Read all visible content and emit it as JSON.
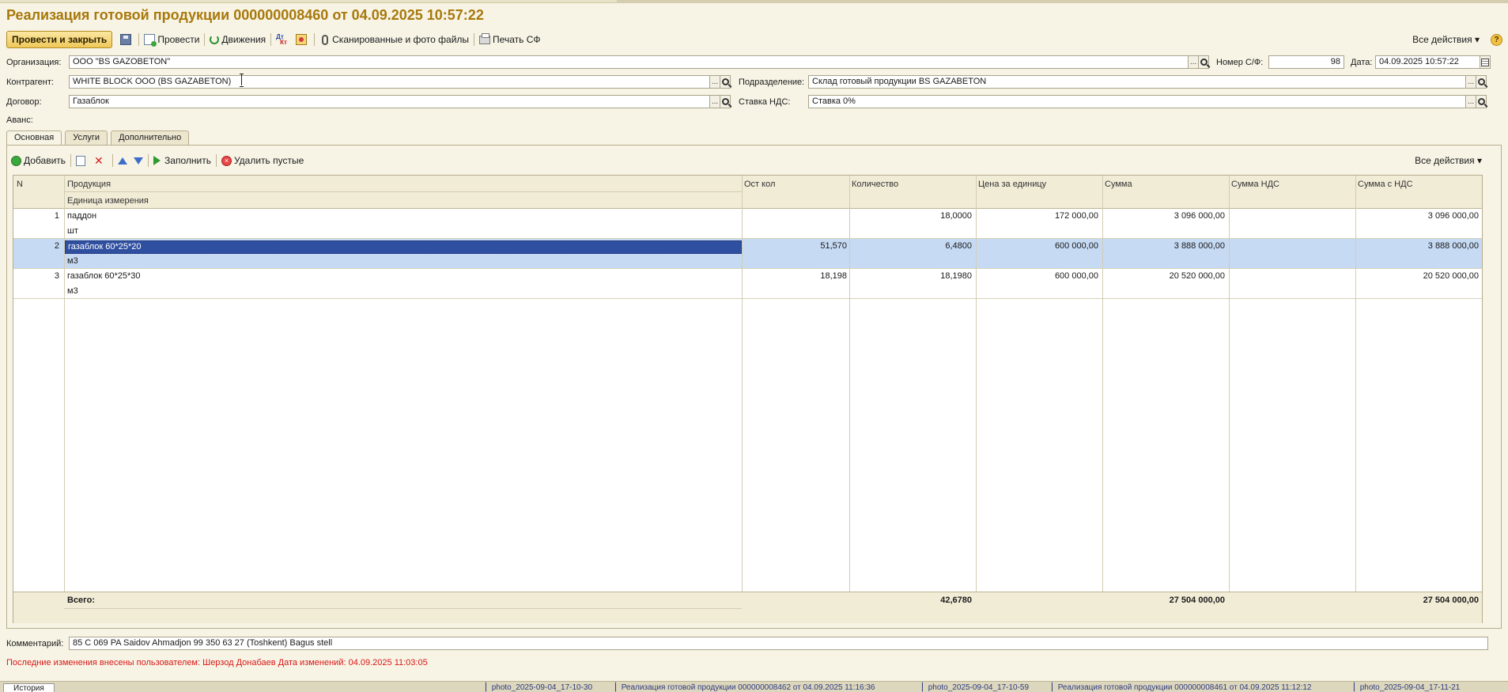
{
  "document": {
    "title": "Реализация готовой продукции 000000008460 от 04.09.2025 10:57:22"
  },
  "toolbar": {
    "post_and_close": "Провести и закрыть",
    "post": "Провести",
    "movements": "Движения",
    "scans": "Сканированные и фото файлы",
    "print_invoice": "Печать СФ",
    "all_actions": "Все действия ▾",
    "help": "?"
  },
  "form": {
    "organization_label": "Организация:",
    "organization_value": "ООО \"BS GAZOBETON\"",
    "invoice_no_label": "Номер С/Ф:",
    "invoice_no_value": "98",
    "date_label": "Дата:",
    "date_value": "04.09.2025 10:57:22",
    "counterparty_label": "Контрагент:",
    "counterparty_value": "WHITE BLOCK OOO (BS GAZABETON)",
    "division_label": "Подразделение:",
    "division_value": "Склад готовый продукции BS GAZABETON",
    "contract_label": "Договор:",
    "contract_value": "Газаблок",
    "vat_rate_label": "Ставка НДС:",
    "vat_rate_value": "Ставка 0%",
    "advance_label": "Аванс:",
    "ellipsis": "..."
  },
  "tabs": [
    {
      "label": "Основная"
    },
    {
      "label": "Услуги"
    },
    {
      "label": "Дополнительно"
    }
  ],
  "table_toolbar": {
    "add": "Добавить",
    "fill": "Заполнить",
    "remove_empty": "Удалить пустые",
    "all_actions": "Все действия ▾"
  },
  "table": {
    "headers": {
      "n": "N",
      "product": "Продукция",
      "unit": "Единица измерения",
      "stock_qty": "Ост кол",
      "quantity": "Количество",
      "unit_price": "Цена за единицу",
      "sum": "Сумма",
      "vat_sum": "Сумма НДС",
      "sum_with_vat": "Сумма с НДС"
    },
    "rows": [
      {
        "n": "1",
        "product": "паддон",
        "unit": "шт",
        "stock_qty": "",
        "quantity": "18,0000",
        "unit_price": "172 000,00",
        "sum": "3 096 000,00",
        "vat_sum": "",
        "sum_with_vat": "3 096 000,00"
      },
      {
        "n": "2",
        "product": "газаблок 60*25*20",
        "unit": "м3",
        "stock_qty": "51,570",
        "quantity": "6,4800",
        "unit_price": "600 000,00",
        "sum": "3 888 000,00",
        "vat_sum": "",
        "sum_with_vat": "3 888 000,00"
      },
      {
        "n": "3",
        "product": "газаблок 60*25*30",
        "unit": "м3",
        "stock_qty": "18,198",
        "quantity": "18,1980",
        "unit_price": "600 000,00",
        "sum": "20 520 000,00",
        "vat_sum": "",
        "sum_with_vat": "20 520 000,00"
      }
    ],
    "selected_row": 2,
    "footer": {
      "label": "Всего:",
      "quantity": "42,6780",
      "sum": "27 504 000,00",
      "sum_with_vat": "27 504 000,00"
    }
  },
  "comment": {
    "label": "Комментарий:",
    "value": "85 С 069 PA Saidov Ahmadjon 99 350 63 27  (Toshkent) Bagus stell"
  },
  "status_line": "Последние изменения внесены пользователем: Шерзод Донабаев Дата изменений: 04.09.2025 11:03:05",
  "taskbar": {
    "history": "История",
    "items": [
      "photo_2025-09-04_17-10-30",
      "Реализация готовой продукции 000000008462 от 04.09.2025 11:16:36",
      "photo_2025-09-04_17-10-59",
      "Реализация готовой продукции 000000008461 от 04.09.2025 11:12:12",
      "photo_2025-09-04_17-11-21"
    ]
  },
  "colors": {
    "title": "#a8780a",
    "status": "#d81818",
    "selection": "#c6daf4",
    "background": "#f7f4e6"
  }
}
